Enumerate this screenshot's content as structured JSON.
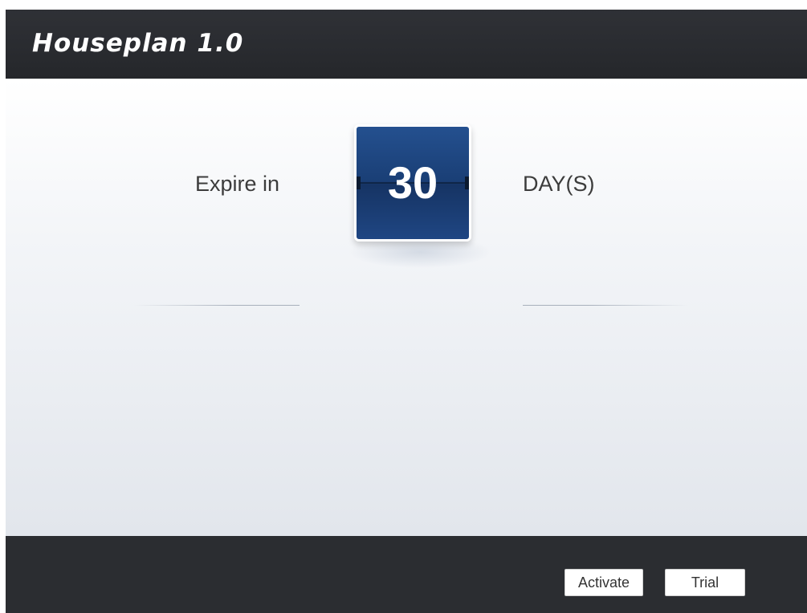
{
  "window": {
    "title": "Houseplan 1.0"
  },
  "license": {
    "prefix_label": "Expire in",
    "days_remaining": "30",
    "suffix_label": "DAY(S)"
  },
  "footer": {
    "activate_label": "Activate",
    "trial_label": "Trial"
  },
  "colors": {
    "titlebar": "#2b2d31",
    "counter_blue": "#1a3f76",
    "text": "#3c3c3c"
  }
}
